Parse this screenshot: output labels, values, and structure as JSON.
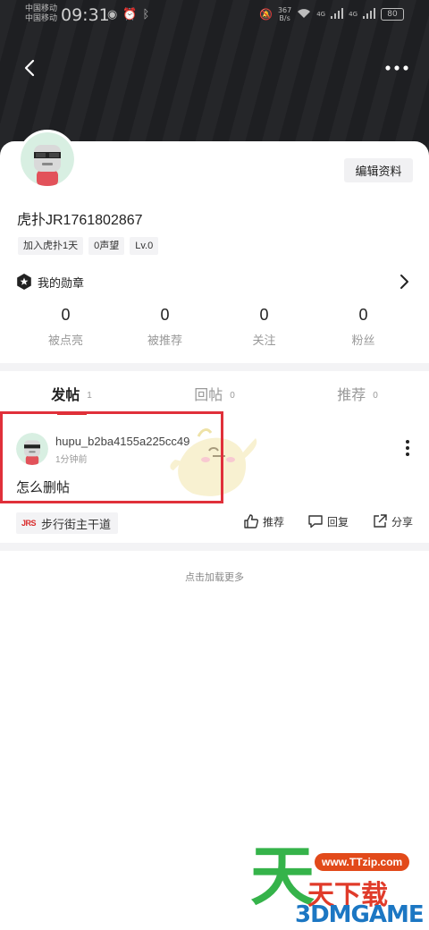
{
  "status_bar": {
    "carrier_1": "中国移动",
    "carrier_2": "中国移动",
    "time": "09:31",
    "speed_value": "367",
    "speed_unit": "B/s",
    "signal_1": "4G",
    "signal_2": "4G",
    "battery": "80"
  },
  "profile": {
    "edit_label": "编辑资料",
    "username": "虎扑JR1761802867",
    "tags": [
      "加入虎扑1天",
      "0声望",
      "Lv.0"
    ],
    "badges_label": "我的勋章",
    "stats": [
      {
        "value": "0",
        "label": "被点亮"
      },
      {
        "value": "0",
        "label": "被推荐"
      },
      {
        "value": "0",
        "label": "关注"
      },
      {
        "value": "0",
        "label": "粉丝"
      }
    ]
  },
  "tabs": [
    {
      "label": "发帖",
      "count": "1",
      "active": true
    },
    {
      "label": "回帖",
      "count": "0",
      "active": false
    },
    {
      "label": "推荐",
      "count": "0",
      "active": false
    }
  ],
  "post": {
    "author": "hupu_b2ba4155a225cc49",
    "time": "1分钟前",
    "title": "怎么删帖",
    "forum_logo": "JRS",
    "forum": "步行街主干道",
    "actions": {
      "recommend": "推荐",
      "reply": "回复",
      "share": "分享"
    }
  },
  "load_more": "点击加载更多",
  "watermark": {
    "url": "www.TTzip.com",
    "big": "天",
    "sub": "天下载",
    "brand": "3DMGAME"
  },
  "colors": {
    "accent": "#d92b2b",
    "highlight": "#e0303a",
    "header_bg": "#1e1f22"
  },
  "icons": {
    "back": "chevron-left-icon",
    "more": "more-horizontal-icon",
    "badge": "star-badge-icon",
    "chevron": "chevron-right-icon",
    "post_menu": "more-vertical-icon",
    "recommend": "thumb-up-icon",
    "reply": "comment-icon",
    "share": "share-icon"
  }
}
